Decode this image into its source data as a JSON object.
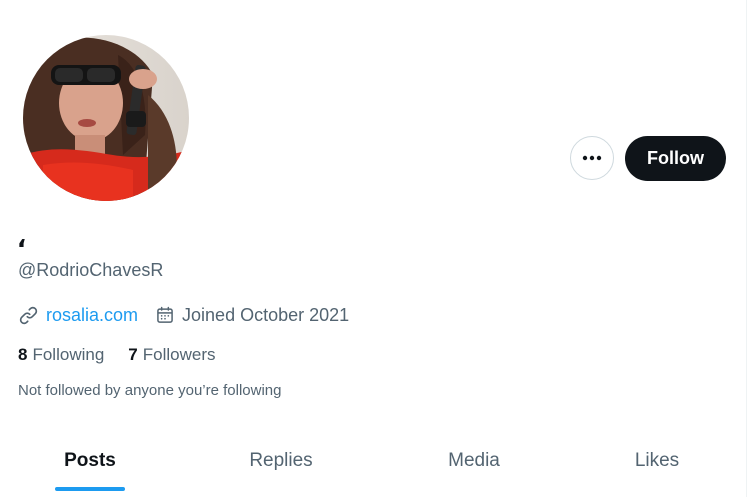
{
  "profile": {
    "display_name": "،",
    "handle": "@RodrioChavesR",
    "website": "rosalia.com",
    "joined": "Joined October 2021",
    "bio_note": "Not followed by anyone you’re following"
  },
  "actions": {
    "follow_label": "Follow",
    "more_icon": "more-horizontal-icon"
  },
  "stats": {
    "following_count": "8",
    "following_label": "Following",
    "followers_count": "7",
    "followers_label": "Followers"
  },
  "tabs": [
    {
      "label": "Posts",
      "active": true
    },
    {
      "label": "Replies",
      "active": false
    },
    {
      "label": "Media",
      "active": false
    },
    {
      "label": "Likes",
      "active": false
    }
  ],
  "icons": {
    "link": "link-icon",
    "calendar": "calendar-icon"
  },
  "colors": {
    "accent": "#1d9bf0",
    "text_primary": "#0f1419",
    "text_secondary": "#536471",
    "button_dark": "#0f1419"
  }
}
